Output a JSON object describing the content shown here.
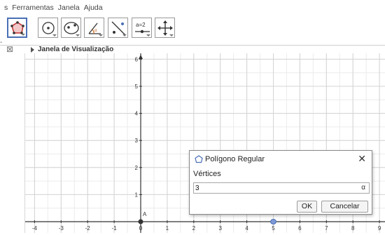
{
  "menu": [
    "s",
    "Ferramentas",
    "Janela",
    "Ajuda"
  ],
  "toolbar": {
    "tools": [
      {
        "name": "regular-polygon-tool-icon",
        "selected": true
      },
      {
        "name": "circle-center-point-tool-icon",
        "selected": false
      },
      {
        "name": "ellipse-tool-icon",
        "selected": false
      },
      {
        "name": "angle-tool-icon",
        "selected": false
      },
      {
        "name": "reflect-about-line-tool-icon",
        "selected": false
      },
      {
        "name": "slider-tool-icon",
        "selected": false,
        "label": "a=2"
      },
      {
        "name": "move-graphics-view-tool-icon",
        "selected": false
      }
    ]
  },
  "view": {
    "title": "Janela de Visualização",
    "close_glyph": "⊠"
  },
  "graph": {
    "x_ticks": [
      -4,
      -3,
      -2,
      -1,
      0,
      1,
      2,
      3,
      4,
      5,
      6,
      7,
      8,
      9
    ],
    "y_ticks": [
      1,
      2,
      3,
      4,
      5,
      6
    ],
    "point_label": "A",
    "accent": "#4a6fb5"
  },
  "dialog": {
    "title": "Polígono Regular",
    "label": "Vértices",
    "input_value": "3",
    "alpha": "α",
    "ok": "OK",
    "cancel": "Cancelar",
    "close": "✕"
  }
}
